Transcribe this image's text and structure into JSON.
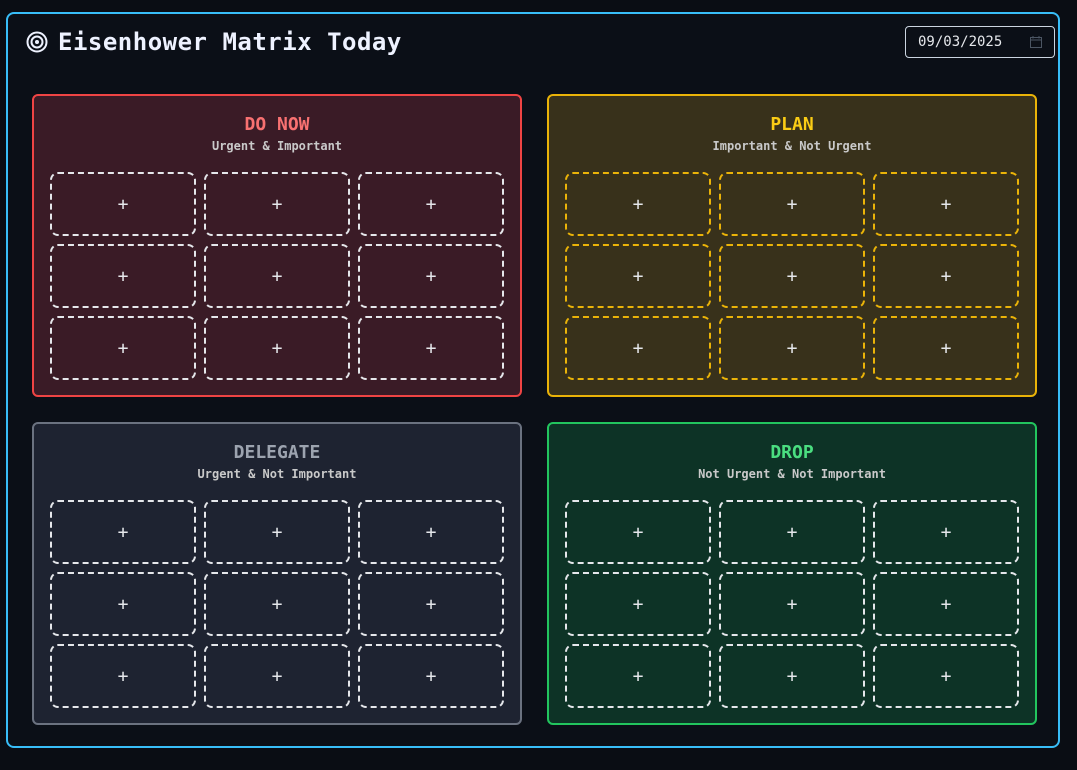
{
  "header": {
    "title": "Eisenhower Matrix Today",
    "icon": "target-icon",
    "date_value": "09/03/2025"
  },
  "colors": {
    "frame": "#38bdf8",
    "do": "#ef4444",
    "plan": "#eab308",
    "delegate": "#6b7280",
    "drop": "#22c55e"
  },
  "quadrants": {
    "do": {
      "title": "DO NOW",
      "subtitle": "Urgent & Important",
      "slots": [
        "+",
        "+",
        "+",
        "+",
        "+",
        "+",
        "+",
        "+",
        "+"
      ]
    },
    "plan": {
      "title": "PLAN",
      "subtitle": "Important & Not Urgent",
      "slots": [
        "+",
        "+",
        "+",
        "+",
        "+",
        "+",
        "+",
        "+",
        "+"
      ]
    },
    "delegate": {
      "title": "DELEGATE",
      "subtitle": "Urgent & Not Important",
      "slots": [
        "+",
        "+",
        "+",
        "+",
        "+",
        "+",
        "+",
        "+",
        "+"
      ]
    },
    "drop": {
      "title": "DROP",
      "subtitle": "Not Urgent & Not Important",
      "slots": [
        "+",
        "+",
        "+",
        "+",
        "+",
        "+",
        "+",
        "+",
        "+"
      ]
    }
  }
}
